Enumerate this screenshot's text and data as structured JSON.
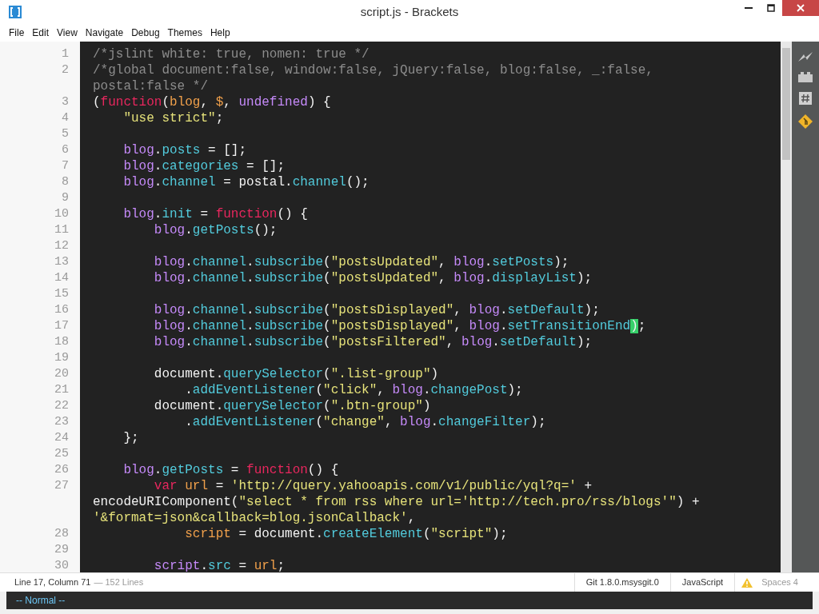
{
  "window": {
    "title": "script.js - Brackets"
  },
  "menu": [
    "File",
    "Edit",
    "View",
    "Navigate",
    "Debug",
    "Themes",
    "Help"
  ],
  "editor": {
    "lines": [
      {
        "number": "1",
        "rows": [
          {
            "segments": [
              {
                "kind": "comment",
                "text": "/*jslint white: true, nomen: true */"
              }
            ]
          }
        ]
      },
      {
        "number": "2",
        "rows": [
          {
            "segments": [
              {
                "kind": "comment",
                "text": "/*global document:false, window:false, jQuery:false, blog:false, _:false,"
              }
            ]
          },
          {
            "segments": [
              {
                "kind": "comment",
                "text": "postal:false */"
              }
            ]
          }
        ]
      },
      {
        "number": "3",
        "rows": [
          {
            "segments": [
              {
                "kind": "plain",
                "text": "("
              },
              {
                "kind": "keyword",
                "text": "function"
              },
              {
                "kind": "plain",
                "text": "("
              },
              {
                "kind": "param",
                "text": "blog"
              },
              {
                "kind": "plain",
                "text": ", "
              },
              {
                "kind": "param",
                "text": "$"
              },
              {
                "kind": "plain",
                "text": ", "
              },
              {
                "kind": "var",
                "text": "undefined"
              },
              {
                "kind": "plain",
                "text": ") {"
              }
            ]
          }
        ]
      },
      {
        "number": "4",
        "rows": [
          {
            "segments": [
              {
                "kind": "string",
                "text": "    \"use strict\""
              },
              {
                "kind": "plain",
                "text": ";"
              }
            ]
          }
        ]
      },
      {
        "number": "5"
      },
      {
        "number": "6",
        "rows": [
          {
            "segments": [
              {
                "kind": "var",
                "text": "    blog"
              },
              {
                "kind": "plain",
                "text": "."
              },
              {
                "kind": "prop",
                "text": "posts"
              },
              {
                "kind": "plain",
                "text": " = [];"
              }
            ]
          }
        ]
      },
      {
        "number": "7",
        "rows": [
          {
            "segments": [
              {
                "kind": "var",
                "text": "    blog"
              },
              {
                "kind": "plain",
                "text": "."
              },
              {
                "kind": "prop",
                "text": "categories"
              },
              {
                "kind": "plain",
                "text": " = [];"
              }
            ]
          }
        ]
      },
      {
        "number": "8",
        "rows": [
          {
            "segments": [
              {
                "kind": "var",
                "text": "    blog"
              },
              {
                "kind": "plain",
                "text": "."
              },
              {
                "kind": "prop",
                "text": "channel"
              },
              {
                "kind": "plain",
                "text": " = postal."
              },
              {
                "kind": "prop",
                "text": "channel"
              },
              {
                "kind": "plain",
                "text": "();"
              }
            ]
          }
        ]
      },
      {
        "number": "9"
      },
      {
        "number": "10",
        "rows": [
          {
            "segments": [
              {
                "kind": "var",
                "text": "    blog"
              },
              {
                "kind": "plain",
                "text": "."
              },
              {
                "kind": "prop",
                "text": "init"
              },
              {
                "kind": "plain",
                "text": " = "
              },
              {
                "kind": "keyword",
                "text": "function"
              },
              {
                "kind": "plain",
                "text": "() {"
              }
            ]
          }
        ]
      },
      {
        "number": "11",
        "rows": [
          {
            "segments": [
              {
                "kind": "var",
                "text": "        blog"
              },
              {
                "kind": "plain",
                "text": "."
              },
              {
                "kind": "prop",
                "text": "getPosts"
              },
              {
                "kind": "plain",
                "text": "();"
              }
            ]
          }
        ]
      },
      {
        "number": "12"
      },
      {
        "number": "13",
        "rows": [
          {
            "segments": [
              {
                "kind": "var",
                "text": "        blog"
              },
              {
                "kind": "plain",
                "text": "."
              },
              {
                "kind": "prop",
                "text": "channel"
              },
              {
                "kind": "plain",
                "text": "."
              },
              {
                "kind": "prop",
                "text": "subscribe"
              },
              {
                "kind": "plain",
                "text": "("
              },
              {
                "kind": "string",
                "text": "\"postsUpdated\""
              },
              {
                "kind": "plain",
                "text": ", "
              },
              {
                "kind": "var",
                "text": "blog"
              },
              {
                "kind": "plain",
                "text": "."
              },
              {
                "kind": "prop",
                "text": "setPosts"
              },
              {
                "kind": "plain",
                "text": ");"
              }
            ]
          }
        ]
      },
      {
        "number": "14",
        "rows": [
          {
            "segments": [
              {
                "kind": "var",
                "text": "        blog"
              },
              {
                "kind": "plain",
                "text": "."
              },
              {
                "kind": "prop",
                "text": "channel"
              },
              {
                "kind": "plain",
                "text": "."
              },
              {
                "kind": "prop",
                "text": "subscribe"
              },
              {
                "kind": "plain",
                "text": "("
              },
              {
                "kind": "string",
                "text": "\"postsUpdated\""
              },
              {
                "kind": "plain",
                "text": ", "
              },
              {
                "kind": "var",
                "text": "blog"
              },
              {
                "kind": "plain",
                "text": "."
              },
              {
                "kind": "prop",
                "text": "displayList"
              },
              {
                "kind": "plain",
                "text": ");"
              }
            ]
          }
        ]
      },
      {
        "number": "15"
      },
      {
        "number": "16",
        "rows": [
          {
            "segments": [
              {
                "kind": "var",
                "text": "        blog"
              },
              {
                "kind": "plain",
                "text": "."
              },
              {
                "kind": "prop",
                "text": "channel"
              },
              {
                "kind": "plain",
                "text": "."
              },
              {
                "kind": "prop",
                "text": "subscribe"
              },
              {
                "kind": "plain",
                "text": "("
              },
              {
                "kind": "string",
                "text": "\"postsDisplayed\""
              },
              {
                "kind": "plain",
                "text": ", "
              },
              {
                "kind": "var",
                "text": "blog"
              },
              {
                "kind": "plain",
                "text": "."
              },
              {
                "kind": "prop",
                "text": "setDefault"
              },
              {
                "kind": "plain",
                "text": ");"
              }
            ]
          }
        ]
      },
      {
        "number": "17",
        "rows": [
          {
            "segments": [
              {
                "kind": "var",
                "text": "        blog"
              },
              {
                "kind": "plain",
                "text": "."
              },
              {
                "kind": "prop",
                "text": "channel"
              },
              {
                "kind": "plain",
                "text": "."
              },
              {
                "kind": "prop",
                "text": "subscribe"
              },
              {
                "kind": "plain",
                "text": "("
              },
              {
                "kind": "string",
                "text": "\"postsDisplayed\""
              },
              {
                "kind": "plain",
                "text": ", "
              },
              {
                "kind": "var",
                "text": "blog"
              },
              {
                "kind": "plain",
                "text": "."
              },
              {
                "kind": "prop",
                "text": "setTransitionEnd"
              },
              {
                "kind": "match",
                "text": ")"
              },
              {
                "kind": "plain",
                "text": ";"
              }
            ]
          }
        ]
      },
      {
        "number": "18",
        "rows": [
          {
            "segments": [
              {
                "kind": "var",
                "text": "        blog"
              },
              {
                "kind": "plain",
                "text": "."
              },
              {
                "kind": "prop",
                "text": "channel"
              },
              {
                "kind": "plain",
                "text": "."
              },
              {
                "kind": "prop",
                "text": "subscribe"
              },
              {
                "kind": "plain",
                "text": "("
              },
              {
                "kind": "string",
                "text": "\"postsFiltered\""
              },
              {
                "kind": "plain",
                "text": ", "
              },
              {
                "kind": "var",
                "text": "blog"
              },
              {
                "kind": "plain",
                "text": "."
              },
              {
                "kind": "prop",
                "text": "setDefault"
              },
              {
                "kind": "plain",
                "text": ");"
              }
            ]
          }
        ]
      },
      {
        "number": "19"
      },
      {
        "number": "20",
        "rows": [
          {
            "segments": [
              {
                "kind": "plain",
                "text": "        document."
              },
              {
                "kind": "prop",
                "text": "querySelector"
              },
              {
                "kind": "plain",
                "text": "("
              },
              {
                "kind": "string",
                "text": "\".list-group\""
              },
              {
                "kind": "plain",
                "text": ")"
              }
            ]
          }
        ]
      },
      {
        "number": "21",
        "rows": [
          {
            "segments": [
              {
                "kind": "plain",
                "text": "            ."
              },
              {
                "kind": "prop",
                "text": "addEventListener"
              },
              {
                "kind": "plain",
                "text": "("
              },
              {
                "kind": "string",
                "text": "\"click\""
              },
              {
                "kind": "plain",
                "text": ", "
              },
              {
                "kind": "var",
                "text": "blog"
              },
              {
                "kind": "plain",
                "text": "."
              },
              {
                "kind": "prop",
                "text": "changePost"
              },
              {
                "kind": "plain",
                "text": ");"
              }
            ]
          }
        ]
      },
      {
        "number": "22",
        "rows": [
          {
            "segments": [
              {
                "kind": "plain",
                "text": "        document."
              },
              {
                "kind": "prop",
                "text": "querySelector"
              },
              {
                "kind": "plain",
                "text": "("
              },
              {
                "kind": "string",
                "text": "\".btn-group\""
              },
              {
                "kind": "plain",
                "text": ")"
              }
            ]
          }
        ]
      },
      {
        "number": "23",
        "rows": [
          {
            "segments": [
              {
                "kind": "plain",
                "text": "            ."
              },
              {
                "kind": "prop",
                "text": "addEventListener"
              },
              {
                "kind": "plain",
                "text": "("
              },
              {
                "kind": "string",
                "text": "\"change\""
              },
              {
                "kind": "plain",
                "text": ", "
              },
              {
                "kind": "var",
                "text": "blog"
              },
              {
                "kind": "plain",
                "text": "."
              },
              {
                "kind": "prop",
                "text": "changeFilter"
              },
              {
                "kind": "plain",
                "text": ");"
              }
            ]
          }
        ]
      },
      {
        "number": "24",
        "rows": [
          {
            "segments": [
              {
                "kind": "plain",
                "text": "    };"
              }
            ]
          }
        ]
      },
      {
        "number": "25"
      },
      {
        "number": "26",
        "rows": [
          {
            "segments": [
              {
                "kind": "var",
                "text": "    blog"
              },
              {
                "kind": "plain",
                "text": "."
              },
              {
                "kind": "prop",
                "text": "getPosts"
              },
              {
                "kind": "plain",
                "text": " = "
              },
              {
                "kind": "keyword",
                "text": "function"
              },
              {
                "kind": "plain",
                "text": "() {"
              }
            ]
          }
        ]
      },
      {
        "number": "27",
        "rows": [
          {
            "segments": [
              {
                "kind": "keyword",
                "text": "        var "
              },
              {
                "kind": "param",
                "text": "url"
              },
              {
                "kind": "plain",
                "text": " = "
              },
              {
                "kind": "string",
                "text": "'http://query.yahooapis.com/v1/public/yql?q='"
              },
              {
                "kind": "plain",
                "text": " +"
              }
            ]
          },
          {
            "segments": [
              {
                "kind": "plain",
                "text": "encodeURIComponent("
              },
              {
                "kind": "string",
                "text": "\"select * from rss where url='http://tech.pro/rss/blogs'\""
              },
              {
                "kind": "plain",
                "text": ") +"
              }
            ]
          },
          {
            "segments": [
              {
                "kind": "string",
                "text": "'&format=json&callback=blog.jsonCallback'"
              },
              {
                "kind": "plain",
                "text": ","
              }
            ]
          }
        ]
      },
      {
        "number": "28",
        "rows": [
          {
            "segments": [
              {
                "kind": "param",
                "text": "            script"
              },
              {
                "kind": "plain",
                "text": " = document."
              },
              {
                "kind": "prop",
                "text": "createElement"
              },
              {
                "kind": "plain",
                "text": "("
              },
              {
                "kind": "string",
                "text": "\"script\""
              },
              {
                "kind": "plain",
                "text": ");"
              }
            ]
          }
        ]
      },
      {
        "number": "29"
      },
      {
        "number": "30",
        "rows": [
          {
            "segments": [
              {
                "kind": "var",
                "text": "        script"
              },
              {
                "kind": "plain",
                "text": "."
              },
              {
                "kind": "prop",
                "text": "src"
              },
              {
                "kind": "plain",
                "text": " = "
              },
              {
                "kind": "param",
                "text": "url"
              },
              {
                "kind": "plain",
                "text": ";"
              }
            ]
          }
        ]
      }
    ]
  },
  "status_bar": {
    "position": "Line 17, Column 71",
    "line_count": "— 152 Lines",
    "git": "Git 1.8.0.msysgit.0",
    "language": "JavaScript",
    "lint_warning": true,
    "indent": "Spaces 4"
  },
  "vim_bar": {
    "mode": "-- Normal --"
  }
}
